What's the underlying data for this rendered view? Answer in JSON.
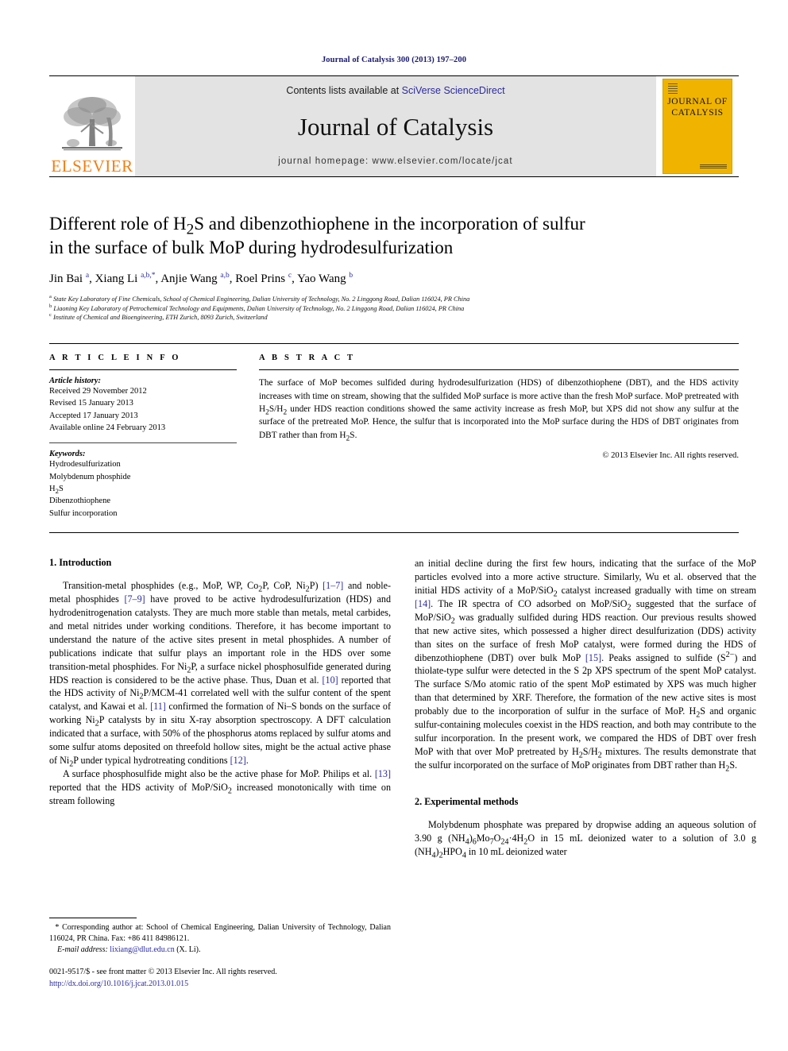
{
  "running_head": "Journal of Catalysis 300 (2013) 197–200",
  "masthead": {
    "publisher_name": "ELSEVIER",
    "contents_prefix": "Contents lists available at ",
    "contents_link": "SciVerse ScienceDirect",
    "journal_name": "Journal of Catalysis",
    "homepage": "journal homepage: www.elsevier.com/locate/jcat",
    "cover_title_line1": "JOURNAL OF",
    "cover_title_line2": "CATALYSIS"
  },
  "article": {
    "title_line1": "Different role of H2S and dibenzothiophene in the incorporation of sulfur",
    "title_line2": "in the surface of bulk MoP during hydrodesulfurization",
    "authors_plain": "Jin Bai a, Xiang Li a,b,*, Anjie Wang a,b, Roel Prins c, Yao Wang b",
    "affiliations": [
      "State Key Laboratory of Fine Chemicals, School of Chemical Engineering, Dalian University of Technology, No. 2 Linggong Road, Dalian 116024, PR China",
      "Liaoning Key Laboratory of Petrochemical Technology and Equipments, Dalian University of Technology, No. 2 Linggong Road, Dalian 116024, PR China",
      "Institute of Chemical and Bioengineering, ETH Zurich, 8093 Zurich, Switzerland"
    ]
  },
  "article_info": {
    "heading": "A R T I C L E   I N F O",
    "history_label": "Article history:",
    "history": [
      "Received 29 November 2012",
      "Revised 15 January 2013",
      "Accepted 17 January 2013",
      "Available online 24 February 2013"
    ],
    "keywords_label": "Keywords:",
    "keywords": [
      "Hydrodesulfurization",
      "Molybdenum phosphide",
      "H2S",
      "Dibenzothiophene",
      "Sulfur incorporation"
    ]
  },
  "abstract": {
    "heading": "A B S T R A C T",
    "copyright": "© 2013 Elsevier Inc. All rights reserved."
  },
  "sections": {
    "intro_heading": "1. Introduction",
    "experimental_heading": "2. Experimental methods"
  },
  "footnote": {
    "corresponding": "Corresponding author at: School of Chemical Engineering, Dalian University of Technology, Dalian 116024, PR China. Fax: +86 411 84986121.",
    "email_label": "E-mail address:",
    "email": "lixiang@dlut.edu.cn",
    "email_owner": "(X. Li).",
    "issn_line": "0021-9517/$ - see front matter © 2013 Elsevier Inc. All rights reserved.",
    "doi": "http://dx.doi.org/10.1016/j.jcat.2013.01.015"
  },
  "colors": {
    "link": "#2b2b9e",
    "elsevier_orange": "#f07f13",
    "cover_yellow": "#f0b400",
    "masthead_gray": "#e3e3e3",
    "running_head": "#1a1a6e"
  }
}
